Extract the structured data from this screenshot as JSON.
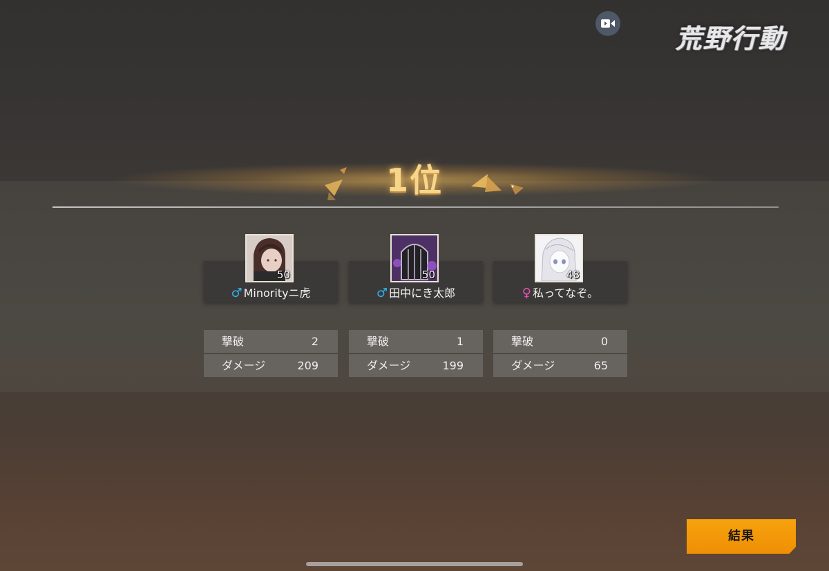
{
  "header": {
    "logo_text": "荒野行動",
    "record_icon": "video-camera-icon"
  },
  "rank": {
    "label": "1位"
  },
  "players": [
    {
      "name": "Minorityニ虎",
      "gender": "male",
      "gender_symbol": "♂",
      "level": "50",
      "stats": {
        "kills_label": "撃破",
        "kills": "2",
        "damage_label": "ダメージ",
        "damage": "209"
      }
    },
    {
      "name": "田中にき太郎",
      "gender": "male",
      "gender_symbol": "♂",
      "level": "50",
      "stats": {
        "kills_label": "撃破",
        "kills": "1",
        "damage_label": "ダメージ",
        "damage": "199"
      }
    },
    {
      "name": "私ってなぞ。",
      "gender": "female",
      "gender_symbol": "♀",
      "level": "48",
      "stats": {
        "kills_label": "撃破",
        "kills": "0",
        "damage_label": "ダメージ",
        "damage": "65"
      }
    }
  ],
  "actions": {
    "result_label": "結果"
  },
  "colors": {
    "accent": "#f29a09",
    "male": "#2eb1e8",
    "female": "#e84fb2",
    "rank_gold": "#f7d68a"
  }
}
